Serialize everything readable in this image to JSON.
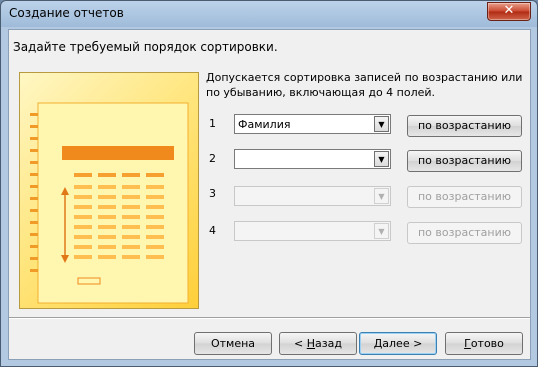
{
  "window": {
    "title": "Создание отчетов",
    "close_glyph": "✕"
  },
  "header": "Задайте требуемый порядок сортировки.",
  "description": "Допускается сортировка записей по возрастанию или по убыванию, включающая до 4 полей.",
  "rows": [
    {
      "num": "1",
      "field": "Фамилия",
      "button": "по возрастанию",
      "enabled": true
    },
    {
      "num": "2",
      "field": "",
      "button": "по возрастанию",
      "enabled": true
    },
    {
      "num": "3",
      "field": "",
      "button": "по возрастанию",
      "enabled": false
    },
    {
      "num": "4",
      "field": "",
      "button": "по возрастанию",
      "enabled": false
    }
  ],
  "buttons": {
    "cancel": "Отмена",
    "back_prefix": "< ",
    "back_hotkey": "Н",
    "back_rest": "азад",
    "next_hotkey": "Д",
    "next_rest": "алее >",
    "finish_hotkey": "Г",
    "finish_rest": "отово"
  },
  "colors": {
    "accent_orange": "#f08a1c",
    "panel_yellow": "#ffe680"
  }
}
